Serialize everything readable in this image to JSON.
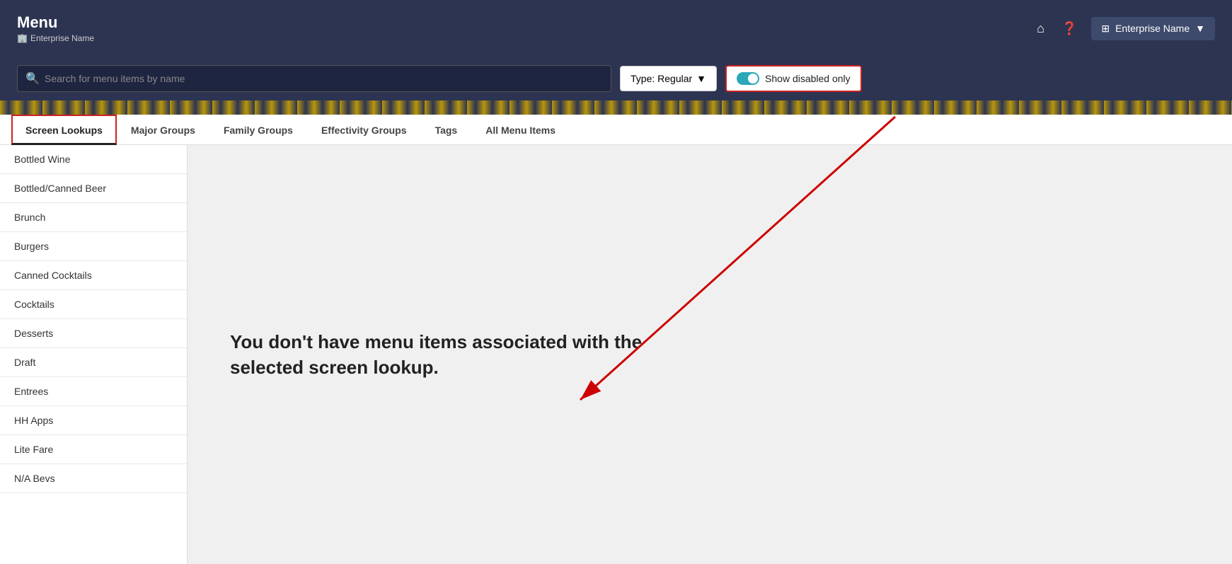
{
  "header": {
    "title": "Menu",
    "subtitle": "Enterprise Name",
    "subtitle_icon": "🏢",
    "home_icon": "⌂",
    "help_icon": "?",
    "enterprise_label": "Enterprise Name",
    "enterprise_icon": "▼"
  },
  "toolbar": {
    "search_placeholder": "Search for menu items by name",
    "type_label": "Type: Regular",
    "type_dropdown_icon": "▼",
    "show_disabled_label": "Show disabled only"
  },
  "tabs": [
    {
      "id": "screen-lookups",
      "label": "Screen Lookups",
      "active": true
    },
    {
      "id": "major-groups",
      "label": "Major Groups",
      "active": false
    },
    {
      "id": "family-groups",
      "label": "Family Groups",
      "active": false
    },
    {
      "id": "effectivity-groups",
      "label": "Effectivity Groups",
      "active": false
    },
    {
      "id": "tags",
      "label": "Tags",
      "active": false
    },
    {
      "id": "all-menu-items",
      "label": "All Menu Items",
      "active": false
    }
  ],
  "sidebar": {
    "items": [
      {
        "label": "Bottled Wine",
        "selected": false
      },
      {
        "label": "Bottled/Canned Beer",
        "selected": false
      },
      {
        "label": "Brunch",
        "selected": false
      },
      {
        "label": "Burgers",
        "selected": false
      },
      {
        "label": "Canned Cocktails",
        "selected": false
      },
      {
        "label": "Cocktails",
        "selected": false
      },
      {
        "label": "Desserts",
        "selected": false
      },
      {
        "label": "Draft",
        "selected": false
      },
      {
        "label": "Entrees",
        "selected": false
      },
      {
        "label": "HH Apps",
        "selected": false
      },
      {
        "label": "Lite Fare",
        "selected": false
      },
      {
        "label": "N/A Bevs",
        "selected": false
      }
    ]
  },
  "main": {
    "empty_message": "You don't have menu items associated with the selected screen lookup."
  }
}
